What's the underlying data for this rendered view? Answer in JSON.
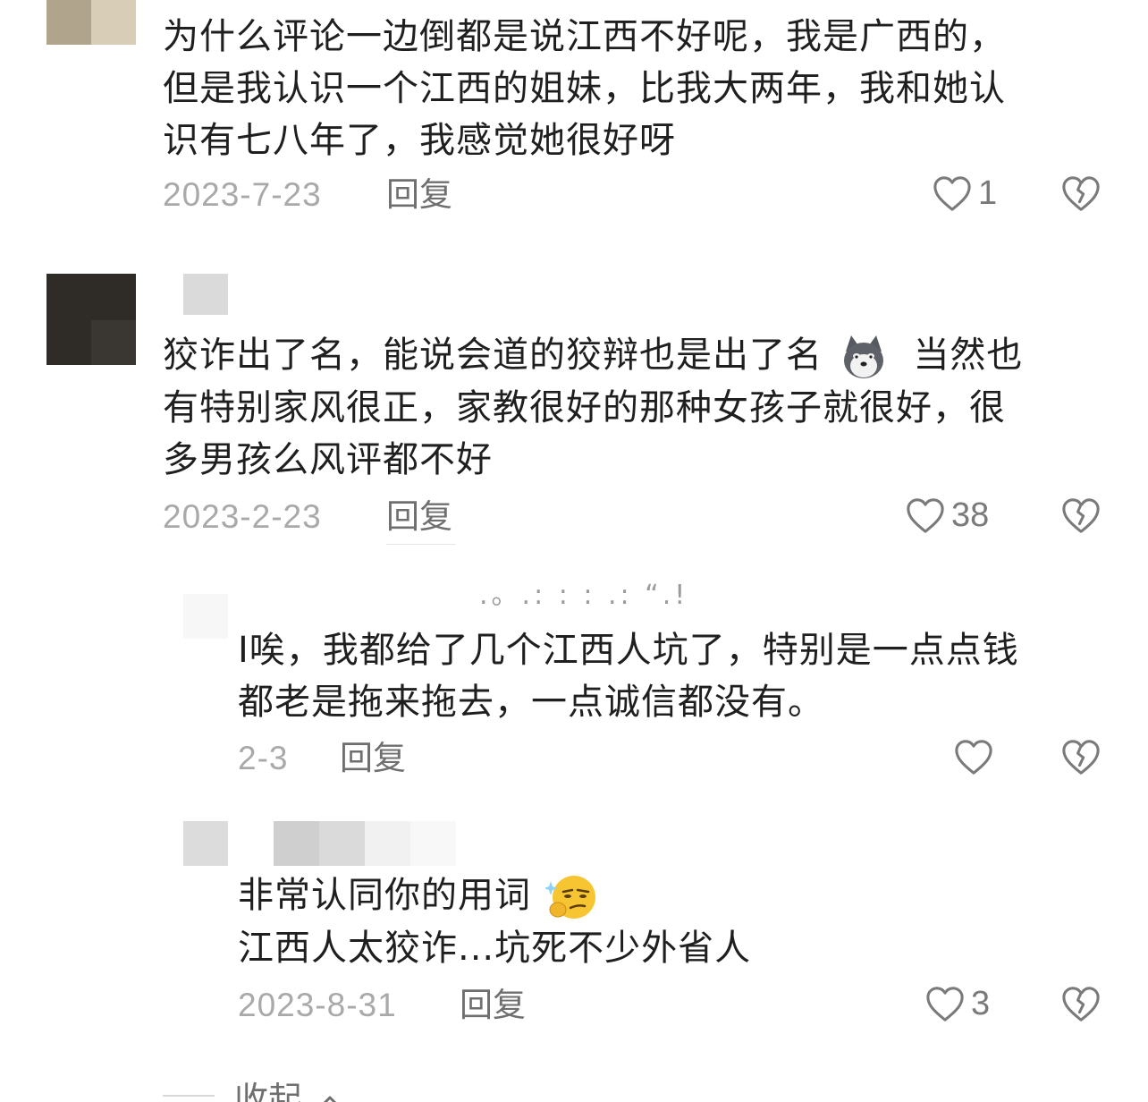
{
  "comments": [
    {
      "lines": [
        "为什么评论一边倒都是说江西不好呢，我是广西的，",
        "但是我认识一个江西的姐妹，比我大两年，我和她认",
        "识有七八年了，我感觉她很好呀"
      ],
      "date": "2023-7-23",
      "reply": "回复",
      "likes": "1"
    },
    {
      "line1_before_emoji": "狡诈出了名，能说会道的狡辩也是出了名",
      "line1_after_emoji": "当然也",
      "line2": "有特别家风很正，家教很好的那种女孩子就很好，很",
      "line3": "多男孩么风评都不好",
      "date": "2023-2-23",
      "reply": "回复",
      "likes": "38"
    }
  ],
  "replies": [
    {
      "username_fragment": ".。.:  :  :  .:  “.!",
      "lines": [
        "I唉，我都给了几个江西人坑了，特别是一点点钱",
        "都老是拖来拖去，一点诚信都没有。"
      ],
      "date": "2-3",
      "reply": "回复"
    },
    {
      "line1": "非常认同你的用词",
      "line2": "江西人太狡诈...坑死不少外省人",
      "date": "2023-8-31",
      "reply": "回复",
      "likes": "3"
    }
  ],
  "collapse_label": "收起",
  "colors": {
    "text": "#1f1f1f",
    "meta": "#a9a9a9",
    "action": "#6f6f6f",
    "icon": "#7a7a7a"
  },
  "icons": {
    "like": "heart-outline-icon",
    "dislike": "broken-heart-icon",
    "emoji_1": "husky-dog-emoji",
    "emoji_2": "smirk-thinking-emoji",
    "collapse": "chevron-up-icon"
  }
}
